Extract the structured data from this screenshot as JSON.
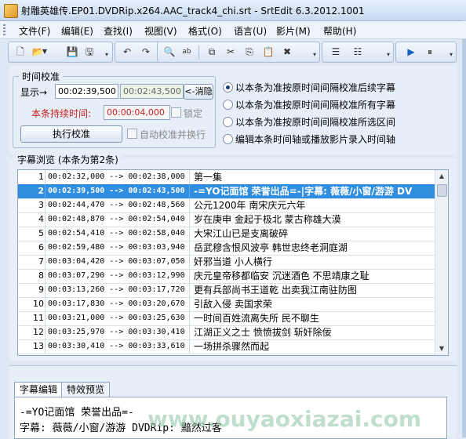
{
  "window": {
    "title": "射雕英雄传.EP01.DVDRip.x264.AAC_track4_chi.srt - SrtEdit 6.3.2012.1001"
  },
  "menu": [
    "文件(F)",
    "编辑(E)",
    "查找(I)",
    "视图(V)",
    "格式(O)",
    "语言(U)",
    "影片(M)",
    "帮助(H)"
  ],
  "time_calibration": {
    "group_title": "时间校准",
    "display_label": "显示→",
    "start_time": "00:02:39,500",
    "end_time": "00:02:43,500",
    "clear_button": "<-消隐",
    "duration_label": "本条持续时间:",
    "duration_value": "00:00:04,000",
    "lock_label": "锁定",
    "execute_button": "执行校准",
    "auto_label": "自动校准并换行"
  },
  "options": [
    {
      "label": "以本条为准按原时间间隔校准后续字幕",
      "selected": true
    },
    {
      "label": "以本条为准按原时间间隔校准所有字幕",
      "selected": false
    },
    {
      "label": "以本条为准按原时间间隔校准所选区间",
      "selected": false
    },
    {
      "label": "编辑本条时间轴或播放影片录入时间轴",
      "selected": false
    }
  ],
  "browse": {
    "title": "字幕浏览 (本条为第2条)",
    "selected_index": 1,
    "rows": [
      {
        "num": "1",
        "time": "00:02:32,000 --> 00:02:38,000",
        "text": "第一集"
      },
      {
        "num": "2",
        "time": "00:02:39,500 --> 00:02:43,500",
        "text": "-=YO记面馆 荣誉出品=-|字幕: 薇薇/小窗/游游  DV"
      },
      {
        "num": "3",
        "time": "00:02:44,470 --> 00:02:48,560",
        "text": "公元1200年 南宋庆元六年"
      },
      {
        "num": "4",
        "time": "00:02:48,870 --> 00:02:54,040",
        "text": "岁在庚申 金起于极北 蒙古称雄大漠"
      },
      {
        "num": "5",
        "time": "00:02:54,410 --> 00:02:58,040",
        "text": "大宋江山已是支离破碎"
      },
      {
        "num": "6",
        "time": "00:02:59,480 --> 00:03:03,940",
        "text": "岳武穆含恨风波亭 韩世忠终老洞庭湖"
      },
      {
        "num": "7",
        "time": "00:03:04,420 --> 00:03:07,050",
        "text": "奸邪当道 小人横行"
      },
      {
        "num": "8",
        "time": "00:03:07,290 --> 00:03:12,990",
        "text": "庆元皇帝移都临安 沉迷酒色 不思靖康之耻"
      },
      {
        "num": "9",
        "time": "00:03:13,260 --> 00:03:17,720",
        "text": "更有兵部尚书王道乾 出卖我江南驻防图"
      },
      {
        "num": "10",
        "time": "00:03:17,830 --> 00:03:20,670",
        "text": "引敌入侵 卖国求荣"
      },
      {
        "num": "11",
        "time": "00:03:21,000 --> 00:03:25,630",
        "text": "一时间百姓流离失所 民不聊生"
      },
      {
        "num": "12",
        "time": "00:03:25,970 --> 00:03:30,410",
        "text": "江湖正义之士 愤愤拔剑 斩奸除佞"
      },
      {
        "num": "13",
        "time": "00:03:30,410 --> 00:03:33,610",
        "text": "一场拼杀骤然而起"
      }
    ]
  },
  "tabs": [
    "字幕编辑",
    "特效预览"
  ],
  "editor": {
    "line1": "-=YO记面馆 荣誉出品=-",
    "line2": "字幕: 薇薇/小窗/游游  DVDRip: 黯然过客"
  },
  "watermark": "www.ouyaoxiazai.com"
}
